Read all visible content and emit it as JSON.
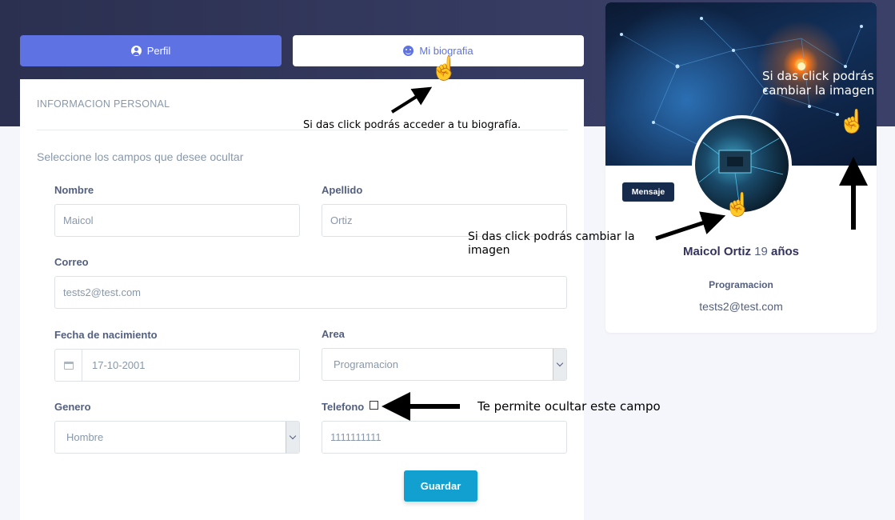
{
  "tabs": {
    "perfil": "Perfil",
    "biografia": "Mi biografia"
  },
  "form": {
    "section_title": "INFORMACION PERSONAL",
    "hint": "Seleccione los campos que desee ocultar",
    "nombre": {
      "label": "Nombre",
      "value": "Maicol"
    },
    "apellido": {
      "label": "Apellido",
      "value": "Ortiz"
    },
    "correo": {
      "label": "Correo",
      "value": "tests2@test.com"
    },
    "fecha": {
      "label": "Fecha de nacimiento",
      "value": "17-10-2001"
    },
    "area": {
      "label": "Area",
      "value": "Programacion"
    },
    "genero": {
      "label": "Genero",
      "value": "Hombre"
    },
    "telefono": {
      "label": "Telefono",
      "value": "1111111111"
    },
    "save_label": "Guardar"
  },
  "profile": {
    "message_button": "Mensaje",
    "name": "Maicol Ortiz",
    "age_number": "19",
    "age_unit": "años",
    "area": "Programacion",
    "email": "tests2@test.com"
  },
  "annotations": {
    "bio_hint": "Si das click podrás acceder a tu biografía.",
    "avatar_hint": "Si das click podrás cambiar la imagen",
    "cover_hint": "Si das click podrás cambiar la imagen",
    "hide_hint": "Te permite ocultar este campo"
  },
  "colors": {
    "primary": "#5e72e4",
    "header": "#2b3050",
    "save": "#11a0d0",
    "dark_button": "#172b4d"
  }
}
